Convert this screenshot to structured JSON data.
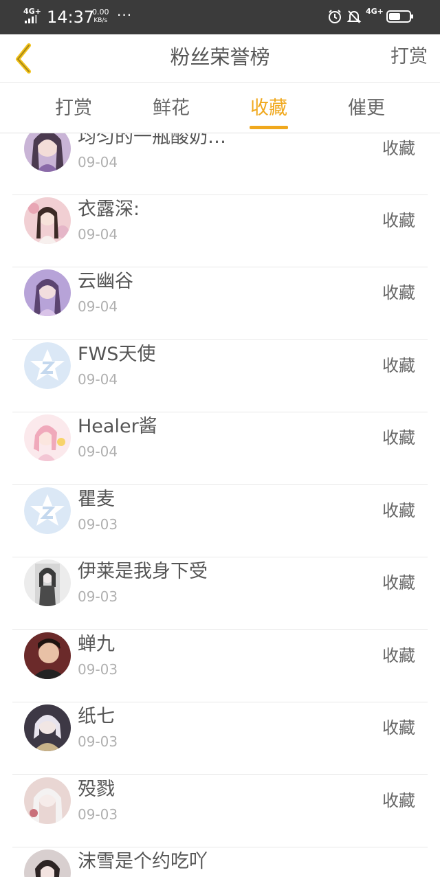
{
  "status_bar": {
    "network_left": "4G+",
    "time": "14:37",
    "speed_value": "0.00",
    "speed_unit": "KB/s",
    "more": "···",
    "network_right": "4G+"
  },
  "header": {
    "title": "粉丝荣誉榜",
    "action_label": "打赏"
  },
  "tabs": [
    {
      "label": "打赏",
      "active": false
    },
    {
      "label": "鲜花",
      "active": false
    },
    {
      "label": "收藏",
      "active": true
    },
    {
      "label": "催更",
      "active": false
    }
  ],
  "colors": {
    "accent": "#f0a81d",
    "status_bar": "#3b3b3b",
    "text": "#555555",
    "muted": "#b0b0b0"
  },
  "fans": [
    {
      "name": "均匀的一瓶酸奶…",
      "date": "09-04",
      "action": "收藏",
      "avatar": "avatar-anime-girl-purple"
    },
    {
      "name": "衣露深:",
      "date": "09-04",
      "action": "收藏",
      "avatar": "avatar-anime-girl-pink"
    },
    {
      "name": "云幽谷",
      "date": "09-04",
      "action": "收藏",
      "avatar": "avatar-anime-girl-violet"
    },
    {
      "name": "FWS天使",
      "date": "09-04",
      "action": "收藏",
      "avatar": "default-star-avatar"
    },
    {
      "name": "Healer酱",
      "date": "09-04",
      "action": "收藏",
      "avatar": "avatar-anime-girl-rose"
    },
    {
      "name": "瞿麦",
      "date": "09-03",
      "action": "收藏",
      "avatar": "default-star-avatar"
    },
    {
      "name": "伊莱是我身下受",
      "date": "09-03",
      "action": "收藏",
      "avatar": "avatar-anime-gray"
    },
    {
      "name": "蝉九",
      "date": "09-03",
      "action": "收藏",
      "avatar": "avatar-man-photo"
    },
    {
      "name": "纸七",
      "date": "09-03",
      "action": "收藏",
      "avatar": "avatar-anime-white-hair"
    },
    {
      "name": "殁戮",
      "date": "09-03",
      "action": "收藏",
      "avatar": "avatar-anime-pale"
    },
    {
      "name": "沫雪是个约吃吖",
      "date": "",
      "action": "",
      "avatar": "avatar-anime-dark"
    }
  ]
}
